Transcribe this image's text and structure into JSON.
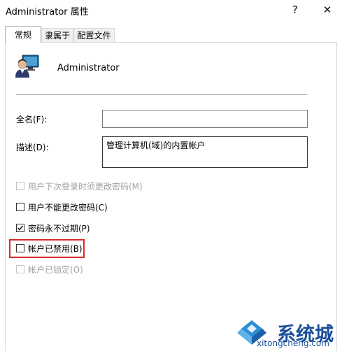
{
  "window": {
    "title": "Administrator 属性"
  },
  "titlebar": {
    "help_glyph": "?",
    "close_glyph": "✕"
  },
  "tabs": [
    {
      "label": "常规"
    },
    {
      "label": "隶属于"
    },
    {
      "label": "配置文件"
    }
  ],
  "user": {
    "name": "Administrator",
    "icon": "user-computer-icon"
  },
  "fields": {
    "fullname_label": "全名(F):",
    "fullname_value": "",
    "description_label": "描述(D):",
    "description_value": "管理计算机(域)的内置帐户"
  },
  "options": [
    {
      "label": "用户下次登录时须更改密码(M)",
      "checked": false,
      "disabled": true
    },
    {
      "label": "用户不能更改密码(C)",
      "checked": false,
      "disabled": false
    },
    {
      "label": "密码永不过期(P)",
      "checked": true,
      "disabled": false
    },
    {
      "label": "帐户已禁用(B)",
      "checked": false,
      "disabled": false
    },
    {
      "label": "帐户已锁定(O)",
      "checked": false,
      "disabled": true
    }
  ],
  "watermark": {
    "text": "系统城",
    "url": "xitongcheng.com"
  },
  "colors": {
    "highlight": "#d92a2a",
    "watermark": "#1b4f9a",
    "checkmark": "#000000"
  }
}
